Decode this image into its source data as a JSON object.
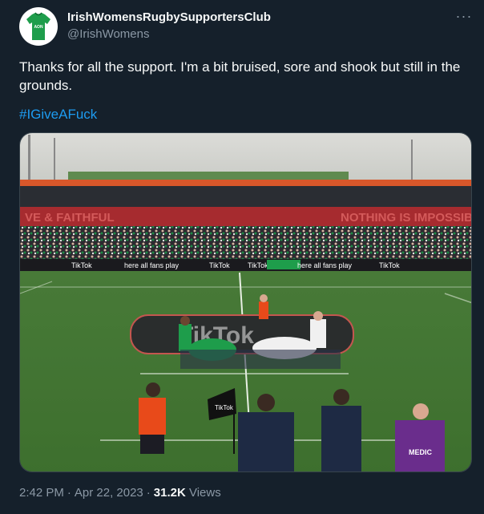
{
  "author": {
    "display_name": "IrishWomensRugbySupportersClub",
    "handle": "@IrishWomens",
    "avatar_jersey_text": "AON"
  },
  "tweet": {
    "text": "Thanks for all the support. I'm a bit bruised, sore and shook but still in the grounds.",
    "hashtag": "#IGiveAFuck"
  },
  "media": {
    "stand_banner_left": "VE & FAITHFUL",
    "stand_banner_right": "NOTHING IS IMPOSSIBLE",
    "ad_boards": [
      "TikTok",
      "here all fans play",
      "TikTok",
      "TikTok",
      "here all fans play",
      "TikTok"
    ],
    "pitch_logo": "TikTok",
    "corner_flag": "TikTok",
    "medic_label": "MEDIC"
  },
  "meta": {
    "time": "2:42 PM",
    "date": "Apr 22, 2023",
    "views_count": "31.2K",
    "views_label": "Views"
  },
  "colors": {
    "background": "#15202b",
    "link": "#1d9bf0",
    "secondary_text": "#8b98a5",
    "irish_green": "#1e9d4b"
  }
}
